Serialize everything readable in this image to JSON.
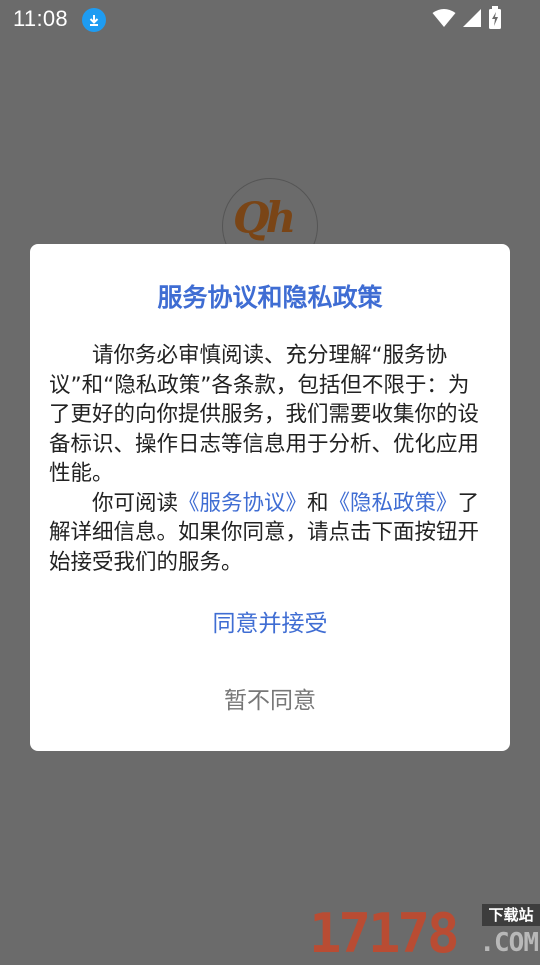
{
  "status_bar": {
    "time": "11:08",
    "icons": [
      "download-icon",
      "wifi-icon",
      "signal-icon",
      "battery-charging-icon"
    ]
  },
  "background": {
    "logo_text": "Qh"
  },
  "dialog": {
    "title": "服务协议和隐私政策",
    "paragraph1": "请你务必审慎阅读、充分理解“服务协议”和“隐私政策”各条款，包括但不限于：为了更好的向你提供服务，我们需要收集你的设备标识、操作日志等信息用于分析、优化应用性能。",
    "p2_prefix": "你可阅读",
    "p2_link_service": "《服务协议》",
    "p2_and": "和",
    "p2_link_privacy": "《隐私政策》",
    "p2_suffix": "了解详细信息。如果你同意，请点击下面按钮开始接受我们的服务。",
    "agree_label": "同意并接受",
    "disagree_label": "暂不同意"
  },
  "watermark": {
    "digits": "17178",
    "tag": "下载站",
    "suffix": ".COM"
  },
  "colors": {
    "accent": "#3f6dd3",
    "overlay": "#6b6b6b",
    "download_badge": "#1e9cf2",
    "watermark_red": "#c7472a"
  }
}
